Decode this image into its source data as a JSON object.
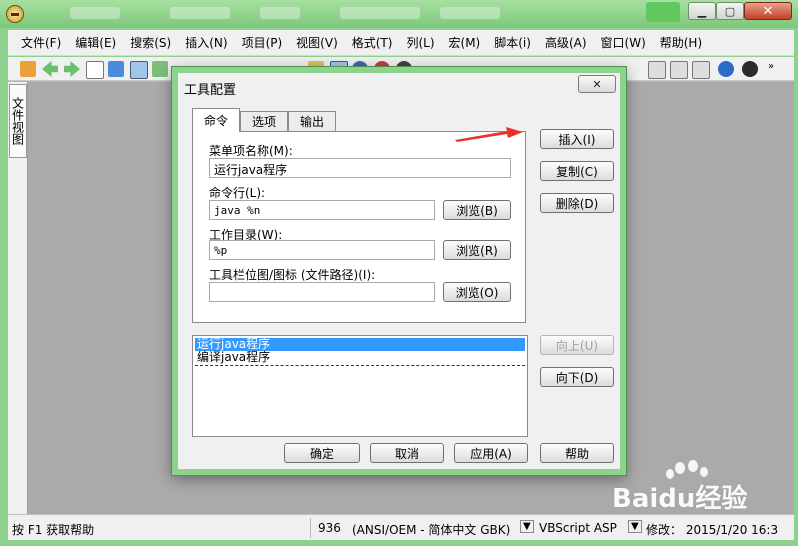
{
  "menubar": {
    "items": [
      "文件(F)",
      "编辑(E)",
      "搜索(S)",
      "插入(N)",
      "项目(P)",
      "视图(V)",
      "格式(T)",
      "列(L)",
      "宏(M)",
      "脚本(i)",
      "高级(A)",
      "窗口(W)",
      "帮助(H)"
    ]
  },
  "sidebar": {
    "tab_label": "文件视图"
  },
  "dialog": {
    "title": "工具配置",
    "close_glyph": "✕",
    "tabs": [
      "命令",
      "选项",
      "输出"
    ],
    "menu_name_label": "菜单项名称(M):",
    "menu_name_value": "运行java程序",
    "command_label": "命令行(L):",
    "command_value": "java %n",
    "workdir_label": "工作目录(W):",
    "workdir_value": "%p",
    "icon_label": "工具栏位图/图标 (文件路径)(I):",
    "icon_value": "",
    "browse_b": "浏览(B)",
    "browse_r": "浏览(R)",
    "browse_o": "浏览(O)",
    "insert": "插入(I)",
    "copy": "复制(C)",
    "delete": "删除(D)",
    "move_up": "向上(U)",
    "move_down": "向下(D)",
    "list": [
      "运行java程序",
      "编译java程序"
    ],
    "ok": "确定",
    "cancel": "取消",
    "apply": "应用(A)",
    "help": "帮助"
  },
  "status": {
    "hint": "按 F1 获取帮助",
    "number": "936",
    "encoding": "(ANSI/OEM - 简体中文 GBK)",
    "language": "VBScript ASP",
    "modified": "修改：  2015/1/20 16:3"
  },
  "watermark": {
    "text": "Baidu经验"
  },
  "colors": {
    "accent_green": "#8ed08e",
    "selection": "#3399ff",
    "arrow": "#e8332a"
  }
}
